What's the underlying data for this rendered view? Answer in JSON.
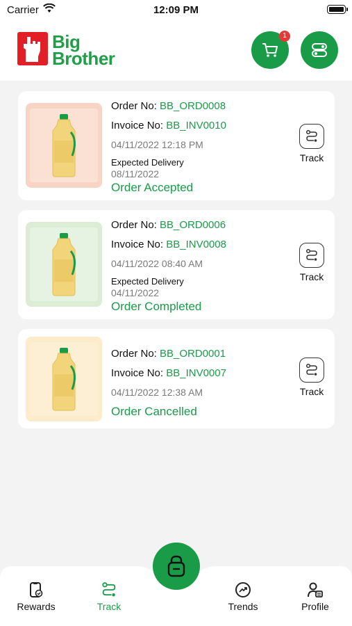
{
  "status_bar": {
    "carrier": "Carrier",
    "time": "12:09 PM"
  },
  "header": {
    "logo_line1": "Big",
    "logo_line2": "Brother",
    "cart_badge": "1"
  },
  "orders": [
    {
      "order_label": "Order No: ",
      "order_no": "BB_ORD0008",
      "invoice_label": "Invoice No: ",
      "invoice_no": "BB_INV0010",
      "datetime": "04/11/2022 12:18 PM",
      "expected_label": "Expected Delivery",
      "expected_date": "08/11/2022",
      "status": "Order Accepted",
      "thumb_color": "#fbe0d4",
      "track_label": "Track"
    },
    {
      "order_label": "Order No: ",
      "order_no": "BB_ORD0006",
      "invoice_label": "Invoice No: ",
      "invoice_no": "BB_INV0008",
      "datetime": "04/11/2022 08:40 AM",
      "expected_label": "Expected Delivery",
      "expected_date": "04/11/2022",
      "status": "Order Completed",
      "thumb_color": "#e6f2e2",
      "track_label": "Track"
    },
    {
      "order_label": "Order No: ",
      "order_no": "BB_ORD0001",
      "invoice_label": "Invoice No: ",
      "invoice_no": "BB_INV0007",
      "datetime": "04/11/2022 12:38 AM",
      "status": "Order Cancelled",
      "thumb_color": "#fdefd3",
      "track_label": "Track"
    }
  ],
  "bottom_nav": {
    "rewards": "Rewards",
    "track": "Track",
    "trends": "Trends",
    "profile": "Profile"
  },
  "colors": {
    "accent": "#1a9b48",
    "badge": "#e53935",
    "logo_red": "#e21e26"
  }
}
